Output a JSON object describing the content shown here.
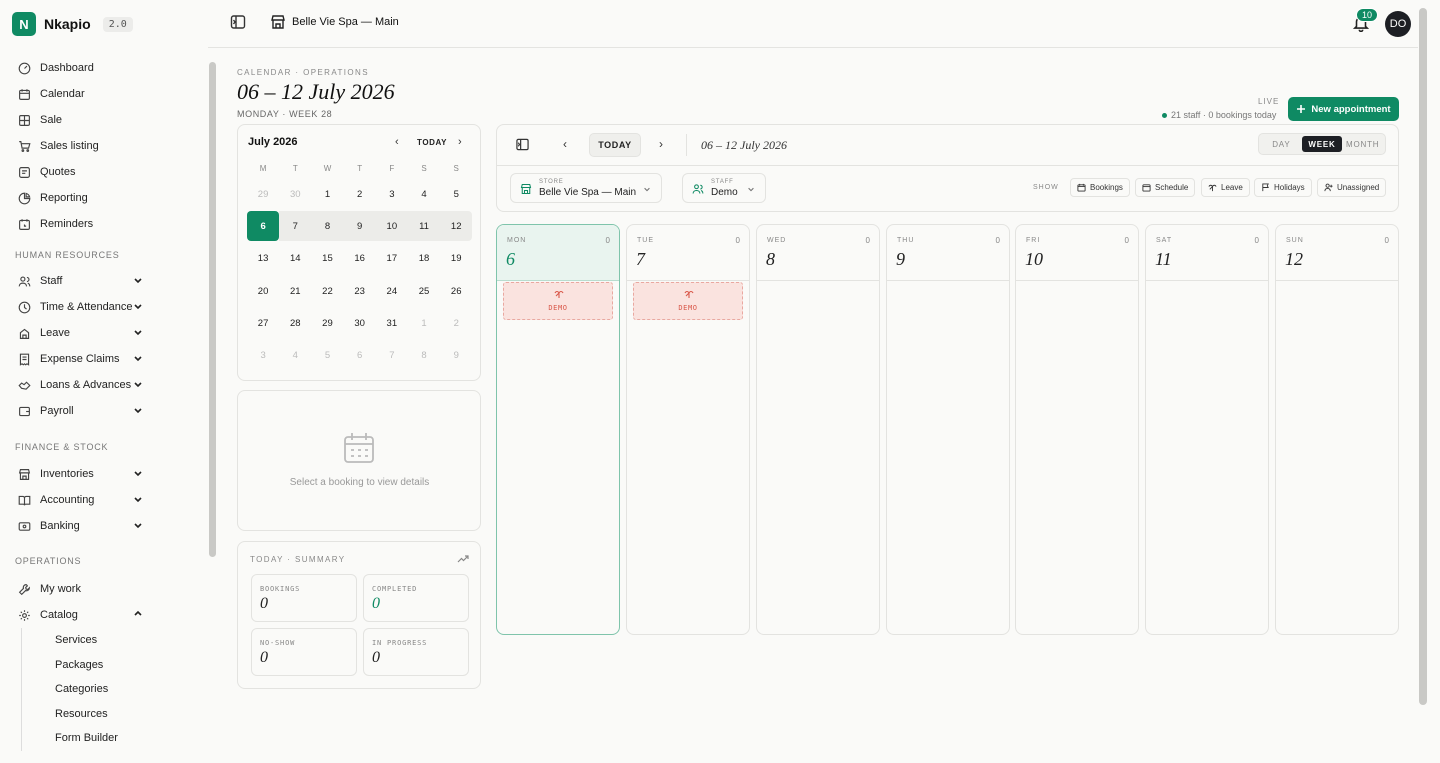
{
  "app": {
    "brand_letter": "N",
    "name": "Nkapio",
    "version": "2.0"
  },
  "topbar": {
    "store": "Belle Vie Spa — Main",
    "notifications": "10",
    "avatar": "DO"
  },
  "sidebar": {
    "main": [
      {
        "label": "Dashboard",
        "icon": "gauge-icon"
      },
      {
        "label": "Calendar",
        "icon": "calendar-icon"
      },
      {
        "label": "Sale",
        "icon": "register-icon"
      },
      {
        "label": "Sales listing",
        "icon": "cart-icon"
      },
      {
        "label": "Quotes",
        "icon": "quote-icon"
      },
      {
        "label": "Reporting",
        "icon": "chart-icon"
      },
      {
        "label": "Reminders",
        "icon": "reminder-icon"
      }
    ],
    "hr_section": "HUMAN RESOURCES",
    "hr": [
      {
        "label": "Staff",
        "icon": "users-icon"
      },
      {
        "label": "Time & Attendance",
        "icon": "clock-icon"
      },
      {
        "label": "Leave",
        "icon": "leave-icon"
      },
      {
        "label": "Expense Claims",
        "icon": "receipt-icon"
      },
      {
        "label": "Loans & Advances",
        "icon": "handshake-icon"
      },
      {
        "label": "Payroll",
        "icon": "wallet-icon"
      }
    ],
    "fin_section": "FINANCE & STOCK",
    "fin": [
      {
        "label": "Inventories",
        "icon": "store-icon"
      },
      {
        "label": "Accounting",
        "icon": "book-icon"
      },
      {
        "label": "Banking",
        "icon": "bank-card-icon"
      }
    ],
    "ops_section": "OPERATIONS",
    "ops": [
      {
        "label": "My work",
        "icon": "wrench-icon"
      },
      {
        "label": "Catalog",
        "icon": "gear-icon"
      }
    ],
    "catalog_sub": [
      "Services",
      "Packages",
      "Categories",
      "Resources",
      "Form Builder"
    ]
  },
  "header": {
    "eyebrow": "CALENDAR · OPERATIONS",
    "title": "06 – 12 July 2026",
    "sub": "MONDAY · WEEK 28",
    "live_label": "LIVE",
    "live_info": "21 staff · 0 bookings today",
    "new_button": "New appointment"
  },
  "mini_calendar": {
    "month": "July 2026",
    "today_label": "TODAY",
    "dow": [
      "M",
      "T",
      "W",
      "T",
      "F",
      "S",
      "S"
    ],
    "weeks": [
      [
        "29",
        "30",
        "1",
        "2",
        "3",
        "4",
        "5"
      ],
      [
        "6",
        "7",
        "8",
        "9",
        "10",
        "11",
        "12"
      ],
      [
        "13",
        "14",
        "15",
        "16",
        "17",
        "18",
        "19"
      ],
      [
        "20",
        "21",
        "22",
        "23",
        "24",
        "25",
        "26"
      ],
      [
        "27",
        "28",
        "29",
        "30",
        "31",
        "1",
        "2"
      ],
      [
        "3",
        "4",
        "5",
        "6",
        "7",
        "8",
        "9"
      ]
    ],
    "selected": "6"
  },
  "details": {
    "empty_text": "Select a booking to view details"
  },
  "summary": {
    "label": "TODAY · SUMMARY",
    "bookings_label": "BOOKINGS",
    "bookings": "0",
    "completed_label": "COMPLETED",
    "completed": "0",
    "noshow_label": "NO-SHOW",
    "noshow": "0",
    "inprogress_label": "IN PROGRESS",
    "inprogress": "0"
  },
  "toolbar": {
    "today": "TODAY",
    "range": "06 – 12 July 2026",
    "views": [
      "DAY",
      "WEEK",
      "MONTH"
    ],
    "active_view": "WEEK",
    "store_caption": "STORE",
    "store_value": "Belle Vie Spa — Main",
    "staff_caption": "STAFF",
    "staff_value": "Demo",
    "show_label": "SHOW",
    "filters": [
      "Bookings",
      "Schedule",
      "Leave",
      "Holidays",
      "Unassigned"
    ]
  },
  "week": [
    {
      "dow": "MON",
      "num": "6",
      "count": "0",
      "demo": "DEMO"
    },
    {
      "dow": "TUE",
      "num": "7",
      "count": "0",
      "demo": "DEMO"
    },
    {
      "dow": "WED",
      "num": "8",
      "count": "0"
    },
    {
      "dow": "THU",
      "num": "9",
      "count": "0"
    },
    {
      "dow": "FRI",
      "num": "10",
      "count": "0"
    },
    {
      "dow": "SAT",
      "num": "11",
      "count": "0"
    },
    {
      "dow": "SUN",
      "num": "12",
      "count": "0"
    }
  ],
  "colors": {
    "accent": "#0f8a63",
    "demo": "#d9584a",
    "dark": "#1d1f24"
  }
}
